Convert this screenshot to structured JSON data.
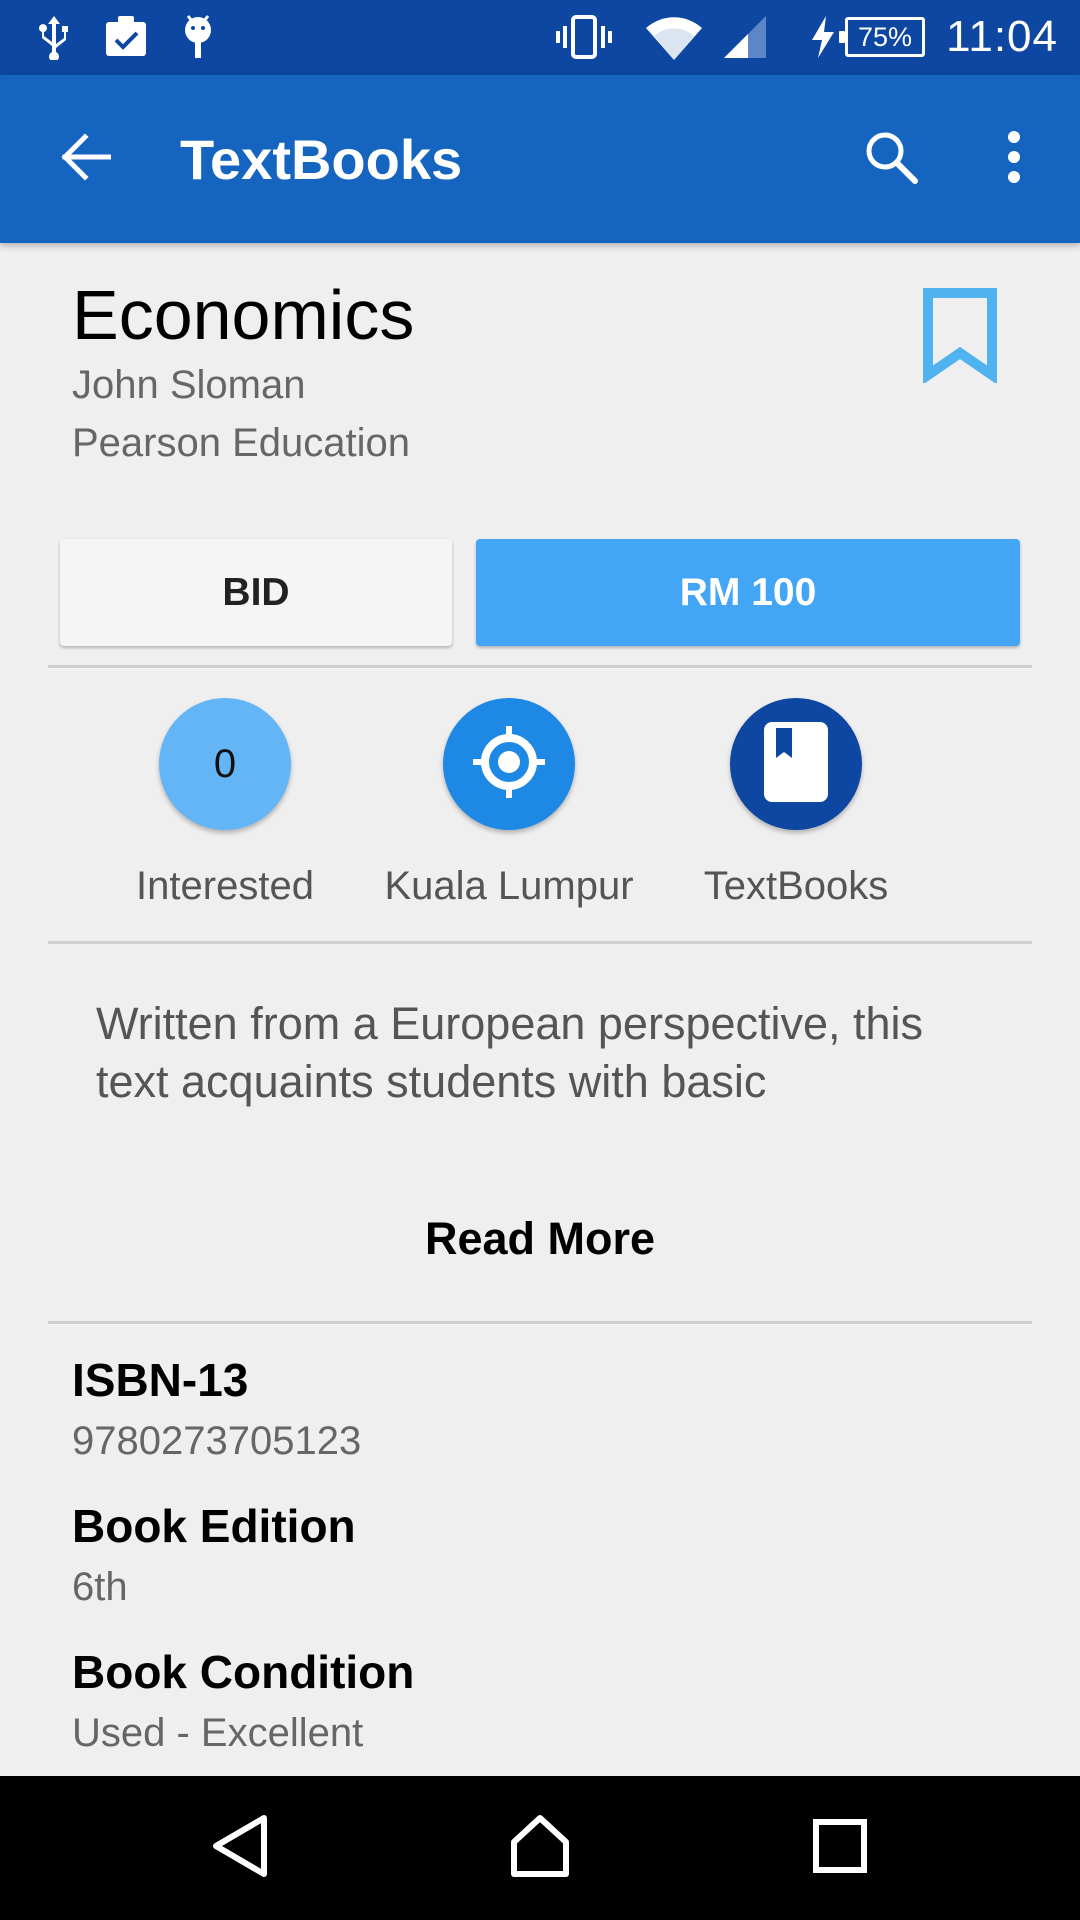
{
  "status_bar": {
    "battery": "75%",
    "time": "11:04",
    "icons": [
      "usb-icon",
      "clipboard-check-icon",
      "android-debug-icon",
      "vibrate-icon",
      "wifi-icon",
      "signal-icon",
      "charging-icon",
      "battery-icon"
    ]
  },
  "app_bar": {
    "title": "TextBooks",
    "icons": [
      "back-arrow-icon",
      "search-icon",
      "overflow-menu-icon"
    ]
  },
  "book": {
    "title": "Economics",
    "author": "John Sloman",
    "publisher": "Pearson Education"
  },
  "actions": {
    "bid_label": "BID",
    "price_label": "RM 100"
  },
  "stats": {
    "interested_count": "0",
    "interested_label": "Interested",
    "location_label": "Kuala Lumpur",
    "category_label": "TextBooks"
  },
  "description": {
    "text": "Written from a European perspective, this text acquaints students with basic",
    "read_more_label": "Read More"
  },
  "details": {
    "isbn_label": "ISBN-13",
    "isbn_value": "9780273705123",
    "edition_label": "Book Edition",
    "edition_value": "6th",
    "condition_label": "Book Condition",
    "condition_value": "Used - Excellent"
  },
  "colors": {
    "status_bar": "#0d47a1",
    "app_bar": "#1565c0",
    "accent": "#42a5f5",
    "bookmark": "#4fb3ef",
    "interested_circle": "#64b5f6",
    "location_circle": "#1e88e5",
    "category_circle": "#0d47a1"
  }
}
